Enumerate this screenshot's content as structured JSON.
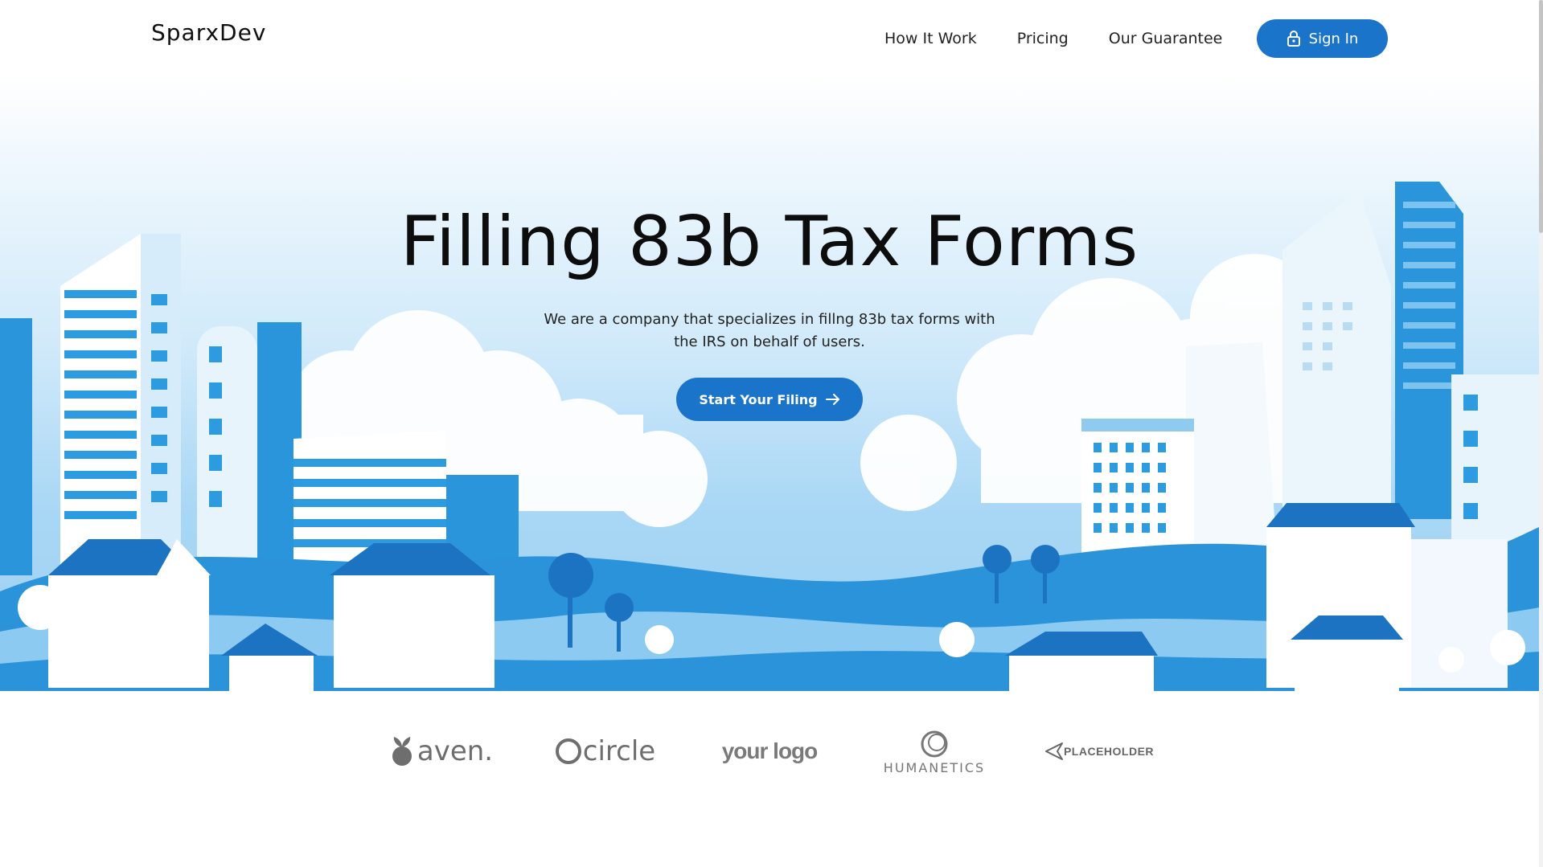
{
  "header": {
    "logo": "SparxDev",
    "nav": [
      "How It Work",
      "Pricing",
      "Our Guarantee"
    ],
    "signin_label": "Sign In"
  },
  "hero": {
    "title": "Filling 83b Tax Forms",
    "subtitle": "We are a company that specializes in fillng 83b tax forms with the IRS on behalf of users.",
    "cta_label": "Start Your Filing"
  },
  "logos": {
    "aven": "aven.",
    "circle": "circle",
    "yourlogo": "your logo",
    "humanetics": "HUMANETICS",
    "placeholder": "PLACEHOLDER"
  },
  "colors": {
    "accent": "#1a74c9",
    "sky": "#cfe9fa",
    "building_blue": "#2d9be0"
  },
  "icons": [
    "lock-icon",
    "arrow-right-icon"
  ]
}
